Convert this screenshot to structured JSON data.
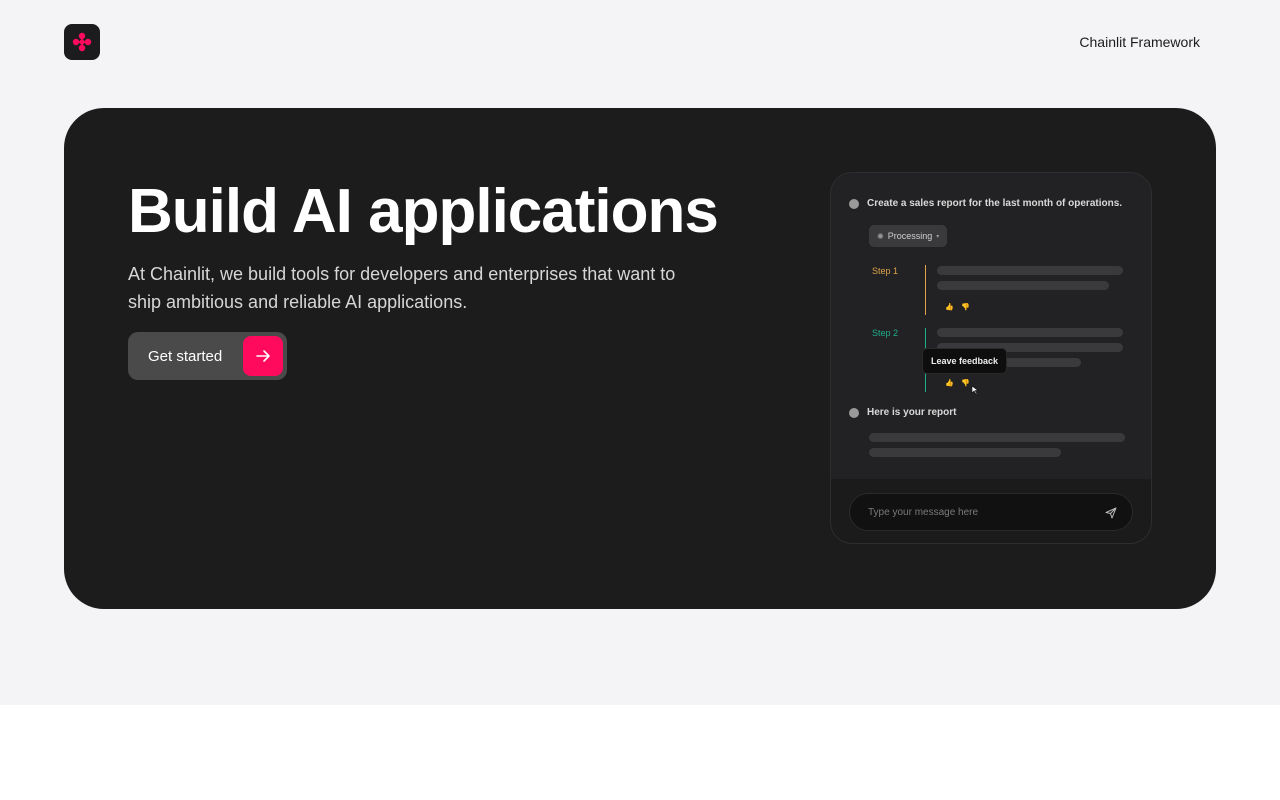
{
  "header": {
    "logo_icon": "chainlit-logo-icon",
    "nav_link": "Chainlit Framework"
  },
  "hero": {
    "title": "Build AI applications",
    "subtitle": "At Chainlit, we build tools for developers and enterprises that want to ship ambitious and reliable AI applications.",
    "cta_label": "Get started",
    "cta_icon": "arrow-right-icon"
  },
  "chat": {
    "user_message": "Create a sales report for the last month of operations.",
    "processing_label": "Processing",
    "step1_label": "Step 1",
    "step2_label": "Step 2",
    "tooltip": "Leave feedback",
    "assistant_message": "Here is your report",
    "input_placeholder": "Type your message here"
  },
  "colors": {
    "accent": "#ff0a5c",
    "step1": "#e0a34a",
    "step2": "#1fae8a",
    "hero_bg": "#1c1c1c",
    "page_bg": "#f4f4f6"
  }
}
